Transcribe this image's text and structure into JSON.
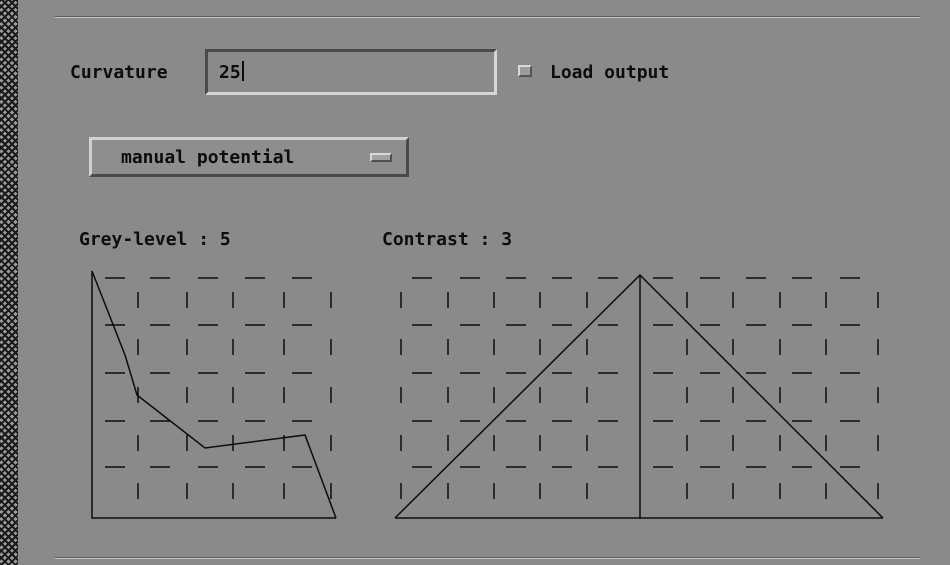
{
  "form": {
    "curvature_label": "Curvature",
    "curvature_value": "25",
    "load_output_label": "Load output",
    "load_output_checked": true,
    "potential_menu_label": "manual potential"
  },
  "grey_level": {
    "label": "Grey-level : 5",
    "value": 5
  },
  "contrast": {
    "label": "Contrast : 3",
    "value": 3
  },
  "colors": {
    "background": "#8a8a8a",
    "text": "#0d0d0d"
  },
  "icons": [
    "checkbox-icon",
    "option-menu-indicator-icon"
  ]
}
